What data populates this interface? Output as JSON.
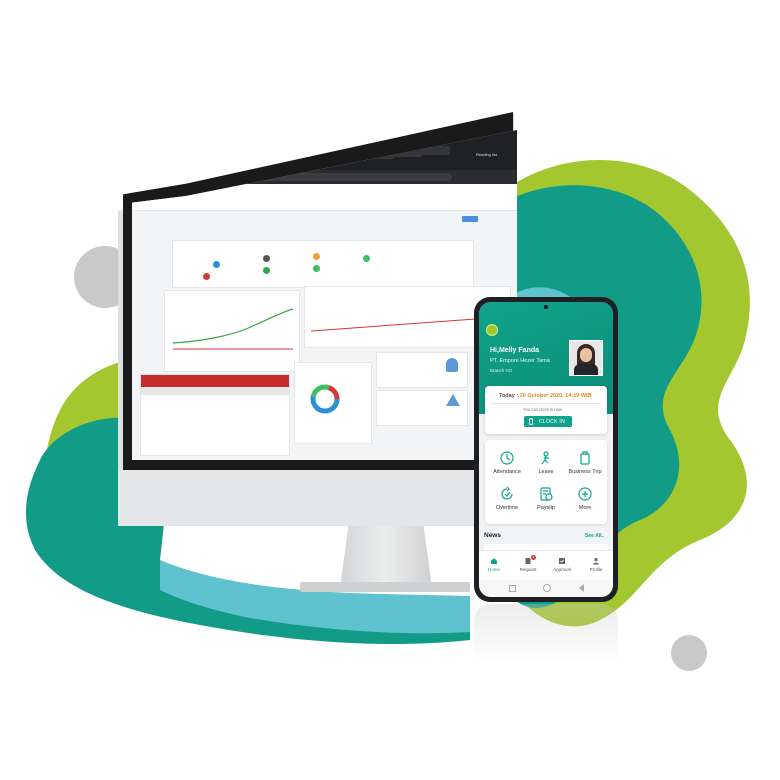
{
  "colors": {
    "teal": "#129b87",
    "lime": "#a3c72f",
    "light_blue": "#5ec2cf",
    "grey_dot": "#c9c9c9",
    "phone_header": "#10a38b",
    "clock_in_button": "#10a38b",
    "date_text": "#e58a1f",
    "chart_line": "#35a845",
    "chart_red": "#d93636"
  },
  "monitor": {
    "browser": {
      "tabs": [
        "",
        "",
        "",
        "",
        "",
        ""
      ],
      "bookmark_label": "Reading list",
      "address": ""
    }
  },
  "phone": {
    "status_time": "",
    "greeting": "Hi,Melly Fanda",
    "company": "PT. Empore Hezer Tama",
    "branch": "Branch HO",
    "today_prefix": "Today : ",
    "today_date": "20 October 2020, 14:19 WIB",
    "clock_hint": "You can clock in now",
    "clock_in_label": "CLOCK IN",
    "menu": [
      {
        "label": "Attendance",
        "icon": "clock-icon"
      },
      {
        "label": "Leave",
        "icon": "leave-icon"
      },
      {
        "label": "Business Trip",
        "icon": "luggage-icon"
      },
      {
        "label": "Overtime",
        "icon": "overtime-icon"
      },
      {
        "label": "Payslip",
        "icon": "payslip-icon"
      },
      {
        "label": "More",
        "icon": "plus-icon"
      }
    ],
    "news_title": "News",
    "see_all": "See All..",
    "nav": [
      {
        "label": "Home",
        "icon": "home-icon"
      },
      {
        "label": "Request",
        "icon": "request-icon",
        "badge": "3"
      },
      {
        "label": "Approval",
        "icon": "approval-icon"
      },
      {
        "label": "Profile",
        "icon": "profile-icon"
      }
    ]
  }
}
